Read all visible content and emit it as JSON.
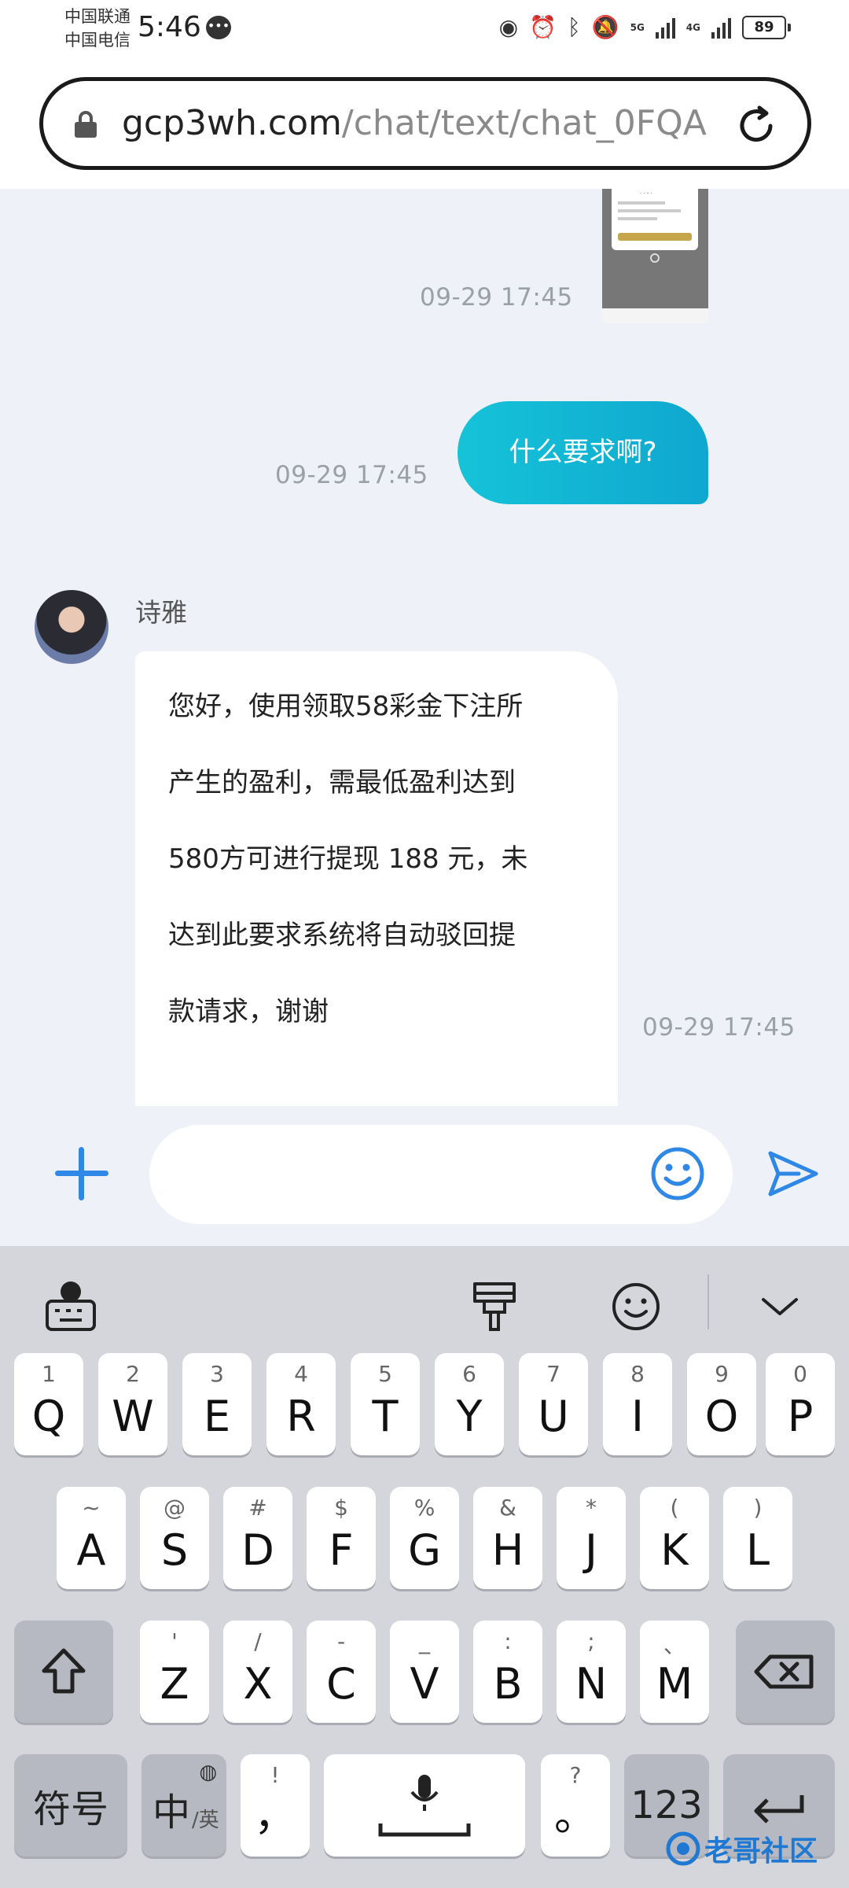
{
  "status_bar": {
    "carrier_1": "中国联通",
    "carrier_2": "中国电信",
    "time": "5:46",
    "signal_1": "5G",
    "signal_2": "4G",
    "battery": "89"
  },
  "url_bar": {
    "host": "gcp3wh.com",
    "path": "/chat/text/chat_0FQA"
  },
  "chat": {
    "messages": [
      {
        "type": "image",
        "direction": "out",
        "time": "09-29 17:45"
      },
      {
        "type": "text",
        "direction": "out",
        "text": "什么要求啊?",
        "time": "09-29 17:45"
      },
      {
        "type": "text",
        "direction": "in",
        "sender": "诗雅",
        "lines": [
          "您好，使用领取58彩金下注所",
          "产生的盈利，需最低盈利达到",
          "580方可进行提现 188 元，未",
          "达到此要求系统将自动驳回提",
          "款请求，谢谢"
        ],
        "time": "09-29 17:45"
      }
    ]
  },
  "input": {
    "placeholder": ""
  },
  "keyboard": {
    "row1": [
      {
        "hint": "1",
        "key": "Q"
      },
      {
        "hint": "2",
        "key": "W"
      },
      {
        "hint": "3",
        "key": "E"
      },
      {
        "hint": "4",
        "key": "R"
      },
      {
        "hint": "5",
        "key": "T"
      },
      {
        "hint": "6",
        "key": "Y"
      },
      {
        "hint": "7",
        "key": "U"
      },
      {
        "hint": "8",
        "key": "I"
      },
      {
        "hint": "9",
        "key": "O"
      },
      {
        "hint": "0",
        "key": "P"
      }
    ],
    "row2": [
      {
        "hint": "~",
        "key": "A"
      },
      {
        "hint": "@",
        "key": "S"
      },
      {
        "hint": "#",
        "key": "D"
      },
      {
        "hint": "$",
        "key": "F"
      },
      {
        "hint": "%",
        "key": "G"
      },
      {
        "hint": "&",
        "key": "H"
      },
      {
        "hint": "*",
        "key": "J"
      },
      {
        "hint": "(",
        "key": "K"
      },
      {
        "hint": ")",
        "key": "L"
      }
    ],
    "row3": [
      {
        "hint": "'",
        "key": "Z"
      },
      {
        "hint": "/",
        "key": "X"
      },
      {
        "hint": "-",
        "key": "C"
      },
      {
        "hint": "_",
        "key": "V"
      },
      {
        "hint": ":",
        "key": "B"
      },
      {
        "hint": ";",
        "key": "N"
      },
      {
        "hint": "、",
        "key": "M"
      }
    ],
    "symbols": "符号",
    "lang_main": "中",
    "lang_sub": "/英",
    "comma_hint": "!",
    "comma": "，",
    "period_hint": "?",
    "period": "。",
    "numbers": "123"
  },
  "watermark": "老哥社区"
}
